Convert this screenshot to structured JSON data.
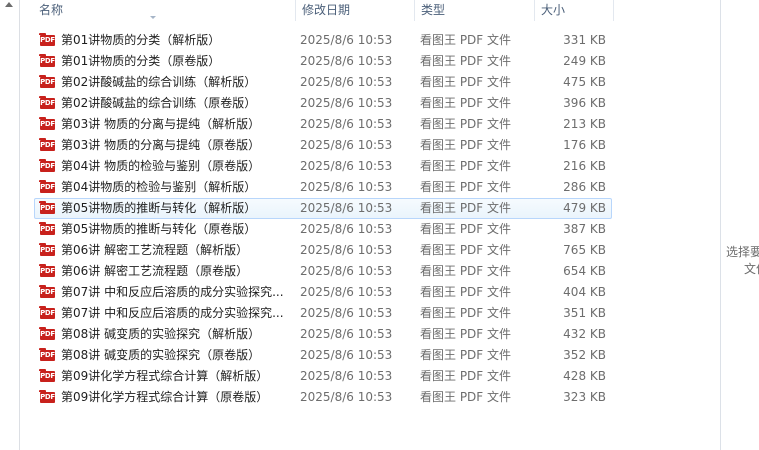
{
  "columns": {
    "name": "名称",
    "date": "修改日期",
    "type": "类型",
    "size": "大小"
  },
  "files": [
    {
      "name": "第01讲物质的分类（解析版）",
      "date": "2025/8/6 10:53",
      "type": "看图王 PDF 文件",
      "size": "331 KB"
    },
    {
      "name": "第01讲物质的分类（原卷版）",
      "date": "2025/8/6 10:53",
      "type": "看图王 PDF 文件",
      "size": "249 KB"
    },
    {
      "name": "第02讲酸碱盐的综合训练（解析版）",
      "date": "2025/8/6 10:53",
      "type": "看图王 PDF 文件",
      "size": "475 KB"
    },
    {
      "name": "第02讲酸碱盐的综合训练（原卷版）",
      "date": "2025/8/6 10:53",
      "type": "看图王 PDF 文件",
      "size": "396 KB"
    },
    {
      "name": "第03讲  物质的分离与提纯（解析版）",
      "date": "2025/8/6 10:53",
      "type": "看图王 PDF 文件",
      "size": "213 KB"
    },
    {
      "name": "第03讲  物质的分离与提纯（原卷版）",
      "date": "2025/8/6 10:53",
      "type": "看图王 PDF 文件",
      "size": "176 KB"
    },
    {
      "name": "第04讲  物质的检验与鉴别（原卷版）",
      "date": "2025/8/6 10:53",
      "type": "看图王 PDF 文件",
      "size": "216 KB"
    },
    {
      "name": "第04讲物质的检验与鉴别（解析版）",
      "date": "2025/8/6 10:53",
      "type": "看图王 PDF 文件",
      "size": "286 KB"
    },
    {
      "name": "第05讲物质的推断与转化（解析版）",
      "date": "2025/8/6 10:53",
      "type": "看图王 PDF 文件",
      "size": "479 KB"
    },
    {
      "name": "第05讲物质的推断与转化（原卷版）",
      "date": "2025/8/6 10:53",
      "type": "看图王 PDF 文件",
      "size": "387 KB"
    },
    {
      "name": "第06讲  解密工艺流程题（解析版）",
      "date": "2025/8/6 10:53",
      "type": "看图王 PDF 文件",
      "size": "765 KB"
    },
    {
      "name": "第06讲  解密工艺流程题（原卷版）",
      "date": "2025/8/6 10:53",
      "type": "看图王 PDF 文件",
      "size": "654 KB"
    },
    {
      "name": "第07讲  中和反应后溶质的成分实验探究...",
      "date": "2025/8/6 10:53",
      "type": "看图王 PDF 文件",
      "size": "404 KB"
    },
    {
      "name": "第07讲  中和反应后溶质的成分实验探究...",
      "date": "2025/8/6 10:53",
      "type": "看图王 PDF 文件",
      "size": "351 KB"
    },
    {
      "name": "第08讲  碱变质的实验探究（解析版）",
      "date": "2025/8/6 10:53",
      "type": "看图王 PDF 文件",
      "size": "432 KB"
    },
    {
      "name": "第08讲  碱变质的实验探究（原卷版）",
      "date": "2025/8/6 10:53",
      "type": "看图王 PDF 文件",
      "size": "352 KB"
    },
    {
      "name": "第09讲化学方程式综合计算（解析版）",
      "date": "2025/8/6 10:53",
      "type": "看图王 PDF 文件",
      "size": "428 KB"
    },
    {
      "name": "第09讲化学方程式综合计算（原卷版）",
      "date": "2025/8/6 10:53",
      "type": "看图王 PDF 文件",
      "size": "323 KB"
    }
  ],
  "selected_index": 8,
  "icon": {
    "name": "pdf-file-icon",
    "label": "PDF",
    "color": "#c8211c"
  },
  "preview": {
    "line1": "选择要",
    "line2": "文件"
  },
  "colors": {
    "header_text": "#4c607a",
    "selection_border": "#b8d6fb",
    "secondary_text": "#6d6d6d"
  }
}
